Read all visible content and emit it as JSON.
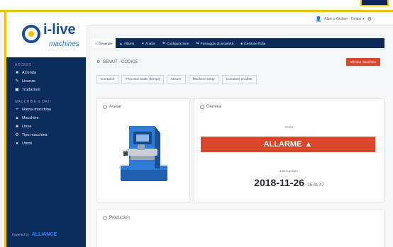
{
  "app": {
    "logo_text": "i-live",
    "logo_sub": "machines"
  },
  "sidebar": {
    "section1": "ACCESS",
    "items1": [
      "Azienda",
      "Licenze",
      "Traduzioni"
    ],
    "section2": "MACCHINE & DATI",
    "items2": [
      "Nuova macchina",
      "Macchine",
      "Linee",
      "Tipo macchina",
      "Utenti"
    ],
    "footer_label": "Powered by",
    "footer_brand": "ALLIANCE"
  },
  "topbar": {
    "user_label": "Alarico Giuliani · Dealer ▾"
  },
  "tabs": [
    "Generale",
    "Allarmi",
    "Analisi",
    "Configurazione",
    "Passaggio di proprietà",
    "Gestione flotta"
  ],
  "header": {
    "machine_code": "GEMU7 · CODICE",
    "button_label": "Elimina macchina"
  },
  "subtabs": [
    "Contatori",
    "Processi totale (tempi)",
    "Misure",
    "Machine setup",
    "Contatori prodotti"
  ],
  "cards": {
    "avatar_title": "Avatar",
    "general_title": "General",
    "status_label": "Stato",
    "alarm_text": "ALLARME",
    "last_update_label": "Last update",
    "last_update_date": "2018-11-26",
    "last_update_time": "15:41:47",
    "production_title": "Production"
  },
  "colors": {
    "navy": "#0b2a5a",
    "alarm_red": "#d9472b",
    "accent_yellow": "#f3c300"
  }
}
